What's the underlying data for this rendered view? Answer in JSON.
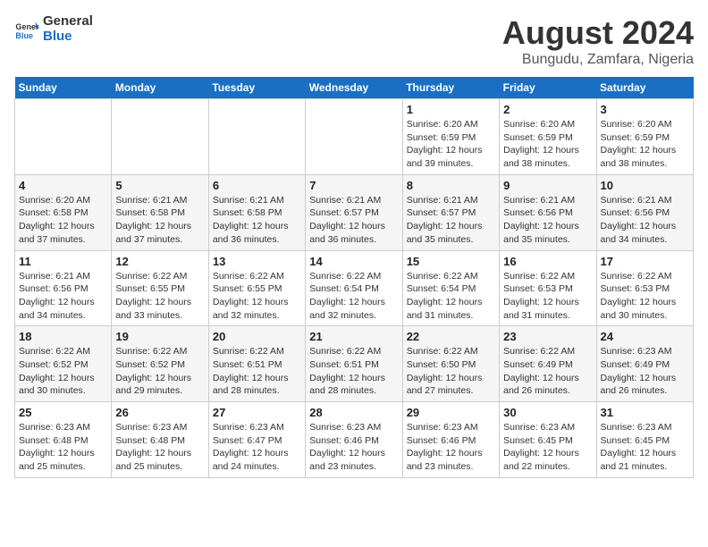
{
  "logo": {
    "line1": "General",
    "line2": "Blue"
  },
  "title": "August 2024",
  "subtitle": "Bungudu, Zamfara, Nigeria",
  "weekdays": [
    "Sunday",
    "Monday",
    "Tuesday",
    "Wednesday",
    "Thursday",
    "Friday",
    "Saturday"
  ],
  "weeks": [
    [
      {
        "day": "",
        "info": ""
      },
      {
        "day": "",
        "info": ""
      },
      {
        "day": "",
        "info": ""
      },
      {
        "day": "",
        "info": ""
      },
      {
        "day": "1",
        "info": "Sunrise: 6:20 AM\nSunset: 6:59 PM\nDaylight: 12 hours and 39 minutes."
      },
      {
        "day": "2",
        "info": "Sunrise: 6:20 AM\nSunset: 6:59 PM\nDaylight: 12 hours and 38 minutes."
      },
      {
        "day": "3",
        "info": "Sunrise: 6:20 AM\nSunset: 6:59 PM\nDaylight: 12 hours and 38 minutes."
      }
    ],
    [
      {
        "day": "4",
        "info": "Sunrise: 6:20 AM\nSunset: 6:58 PM\nDaylight: 12 hours and 37 minutes."
      },
      {
        "day": "5",
        "info": "Sunrise: 6:21 AM\nSunset: 6:58 PM\nDaylight: 12 hours and 37 minutes."
      },
      {
        "day": "6",
        "info": "Sunrise: 6:21 AM\nSunset: 6:58 PM\nDaylight: 12 hours and 36 minutes."
      },
      {
        "day": "7",
        "info": "Sunrise: 6:21 AM\nSunset: 6:57 PM\nDaylight: 12 hours and 36 minutes."
      },
      {
        "day": "8",
        "info": "Sunrise: 6:21 AM\nSunset: 6:57 PM\nDaylight: 12 hours and 35 minutes."
      },
      {
        "day": "9",
        "info": "Sunrise: 6:21 AM\nSunset: 6:56 PM\nDaylight: 12 hours and 35 minutes."
      },
      {
        "day": "10",
        "info": "Sunrise: 6:21 AM\nSunset: 6:56 PM\nDaylight: 12 hours and 34 minutes."
      }
    ],
    [
      {
        "day": "11",
        "info": "Sunrise: 6:21 AM\nSunset: 6:56 PM\nDaylight: 12 hours and 34 minutes."
      },
      {
        "day": "12",
        "info": "Sunrise: 6:22 AM\nSunset: 6:55 PM\nDaylight: 12 hours and 33 minutes."
      },
      {
        "day": "13",
        "info": "Sunrise: 6:22 AM\nSunset: 6:55 PM\nDaylight: 12 hours and 32 minutes."
      },
      {
        "day": "14",
        "info": "Sunrise: 6:22 AM\nSunset: 6:54 PM\nDaylight: 12 hours and 32 minutes."
      },
      {
        "day": "15",
        "info": "Sunrise: 6:22 AM\nSunset: 6:54 PM\nDaylight: 12 hours and 31 minutes."
      },
      {
        "day": "16",
        "info": "Sunrise: 6:22 AM\nSunset: 6:53 PM\nDaylight: 12 hours and 31 minutes."
      },
      {
        "day": "17",
        "info": "Sunrise: 6:22 AM\nSunset: 6:53 PM\nDaylight: 12 hours and 30 minutes."
      }
    ],
    [
      {
        "day": "18",
        "info": "Sunrise: 6:22 AM\nSunset: 6:52 PM\nDaylight: 12 hours and 30 minutes."
      },
      {
        "day": "19",
        "info": "Sunrise: 6:22 AM\nSunset: 6:52 PM\nDaylight: 12 hours and 29 minutes."
      },
      {
        "day": "20",
        "info": "Sunrise: 6:22 AM\nSunset: 6:51 PM\nDaylight: 12 hours and 28 minutes."
      },
      {
        "day": "21",
        "info": "Sunrise: 6:22 AM\nSunset: 6:51 PM\nDaylight: 12 hours and 28 minutes."
      },
      {
        "day": "22",
        "info": "Sunrise: 6:22 AM\nSunset: 6:50 PM\nDaylight: 12 hours and 27 minutes."
      },
      {
        "day": "23",
        "info": "Sunrise: 6:22 AM\nSunset: 6:49 PM\nDaylight: 12 hours and 26 minutes."
      },
      {
        "day": "24",
        "info": "Sunrise: 6:23 AM\nSunset: 6:49 PM\nDaylight: 12 hours and 26 minutes."
      }
    ],
    [
      {
        "day": "25",
        "info": "Sunrise: 6:23 AM\nSunset: 6:48 PM\nDaylight: 12 hours and 25 minutes."
      },
      {
        "day": "26",
        "info": "Sunrise: 6:23 AM\nSunset: 6:48 PM\nDaylight: 12 hours and 25 minutes."
      },
      {
        "day": "27",
        "info": "Sunrise: 6:23 AM\nSunset: 6:47 PM\nDaylight: 12 hours and 24 minutes."
      },
      {
        "day": "28",
        "info": "Sunrise: 6:23 AM\nSunset: 6:46 PM\nDaylight: 12 hours and 23 minutes."
      },
      {
        "day": "29",
        "info": "Sunrise: 6:23 AM\nSunset: 6:46 PM\nDaylight: 12 hours and 23 minutes."
      },
      {
        "day": "30",
        "info": "Sunrise: 6:23 AM\nSunset: 6:45 PM\nDaylight: 12 hours and 22 minutes."
      },
      {
        "day": "31",
        "info": "Sunrise: 6:23 AM\nSunset: 6:45 PM\nDaylight: 12 hours and 21 minutes."
      }
    ]
  ]
}
